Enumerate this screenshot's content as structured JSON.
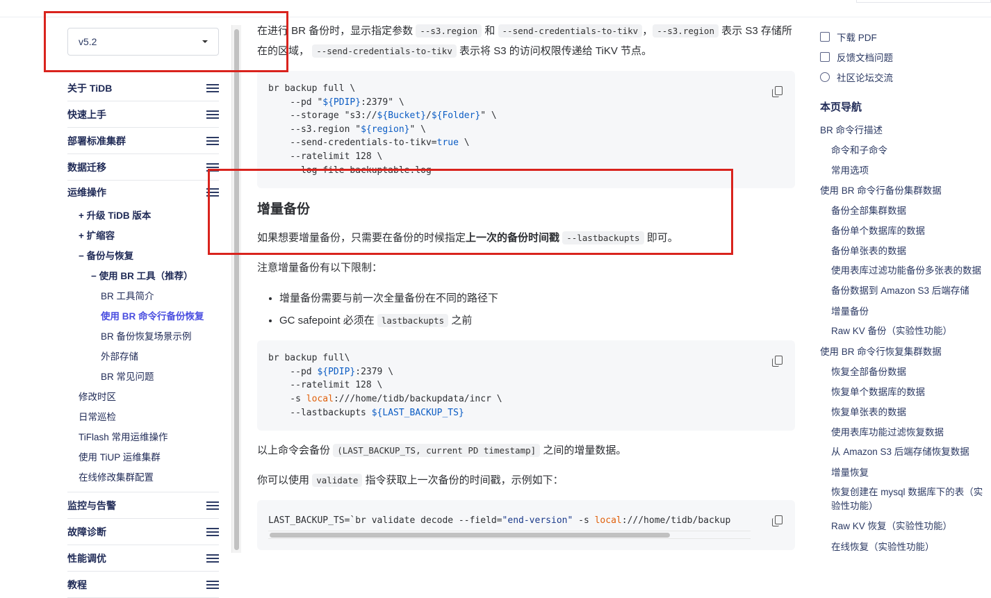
{
  "version": "v5.2",
  "sidebar": {
    "sections_top": [
      "关于 TiDB",
      "快速上手",
      "部署标准集群",
      "数据迁移"
    ],
    "open_section": "运维操作",
    "subs": [
      {
        "label": "+ 升级 TiDB 版本",
        "indent": 1,
        "bold": true
      },
      {
        "label": "+ 扩缩容",
        "indent": 1,
        "bold": true
      },
      {
        "label": "− 备份与恢复",
        "indent": 1,
        "bold": true
      },
      {
        "label": "− 使用 BR 工具（推荐）",
        "indent": 2,
        "bold": true
      },
      {
        "label": "BR 工具简介",
        "indent": 3
      },
      {
        "label": "使用 BR 命令行备份恢复",
        "indent": 3,
        "active": true
      },
      {
        "label": "BR 备份恢复场景示例",
        "indent": 3
      },
      {
        "label": "外部存储",
        "indent": 3
      },
      {
        "label": "BR 常见问题",
        "indent": 3
      },
      {
        "label": "修改时区",
        "indent": 1
      },
      {
        "label": "日常巡检",
        "indent": 1
      },
      {
        "label": "TiFlash 常用运维操作",
        "indent": 1
      },
      {
        "label": "使用 TiUP 运维集群",
        "indent": 1
      },
      {
        "label": "在线修改集群配置",
        "indent": 1
      }
    ],
    "sections_bottom": [
      "监控与告警",
      "故障诊断",
      "性能调优",
      "教程"
    ]
  },
  "main": {
    "p1": {
      "a": "在进行 BR 备份时，显示指定参数",
      "c1": "--s3.region",
      "b": "和",
      "c2": "--send-credentials-to-tikv",
      "c": "，",
      "c3": "--s3.region",
      "d": "表示 S3 存储所在的区域，",
      "c4": "--send-credentials-to-tikv",
      "e": "表示将 S3 的访问权限传递给 TiKV 节点。"
    },
    "code1": [
      [
        [
          "br backup full \\",
          ""
        ]
      ],
      [
        [
          "    --pd \"",
          ""
        ],
        [
          "${PDIP}",
          "k-blue"
        ],
        [
          ":2379\" \\",
          ""
        ]
      ],
      [
        [
          "    --storage \"s3://",
          ""
        ],
        [
          "${Bucket}",
          "k-blue"
        ],
        [
          "/",
          ""
        ],
        [
          "${Folder}",
          "k-blue"
        ],
        [
          "\" \\",
          ""
        ]
      ],
      [
        [
          "    --s3.region \"",
          ""
        ],
        [
          "${region}",
          "k-blue"
        ],
        [
          "\" \\",
          ""
        ]
      ],
      [
        [
          "    --send-credentials-to-tikv=",
          ""
        ],
        [
          "true",
          "k-blue"
        ],
        [
          " \\",
          ""
        ]
      ],
      [
        [
          "    --ratelimit 128 \\",
          ""
        ]
      ],
      [
        [
          "    --log-file backuptable.log",
          ""
        ]
      ]
    ],
    "h_incr": "增量备份",
    "p2": {
      "a": "如果想要增量备份，只需要在备份的时候指定",
      "b": "上一次的备份时间戳",
      "c": "--lastbackupts",
      "d": "即可。"
    },
    "p3": "注意增量备份有以下限制：",
    "li1": "增量备份需要与前一次全量备份在不同的路径下",
    "li2": {
      "a": "GC safepoint 必须在",
      "c": "lastbackupts",
      "b": "之前"
    },
    "code2": [
      [
        [
          "br backup full\\",
          ""
        ]
      ],
      [
        [
          "    --pd ",
          ""
        ],
        [
          "${PDIP}",
          "k-blue"
        ],
        [
          ":2379 \\",
          ""
        ]
      ],
      [
        [
          "    --ratelimit 128 \\",
          ""
        ]
      ],
      [
        [
          "    -s ",
          ""
        ],
        [
          "local",
          "k-orange"
        ],
        [
          ":///home/tidb/backupdata/incr \\",
          ""
        ]
      ],
      [
        [
          "    --lastbackupts ",
          ""
        ],
        [
          "${LAST_BACKUP_TS}",
          "k-blue"
        ]
      ]
    ],
    "p4": {
      "a": "以上命令会备份",
      "c": "(LAST_BACKUP_TS, current PD timestamp]",
      "b": "之间的增量数据。"
    },
    "p5": {
      "a": "你可以使用",
      "c": "validate",
      "b": "指令获取上一次备份的时间戳，示例如下："
    },
    "code3": [
      [
        [
          "LAST_BACKUP_TS=`br validate decode --field=",
          ""
        ],
        [
          "\"end-version\"",
          "k-navy"
        ],
        [
          " -s ",
          ""
        ],
        [
          "local",
          "k-orange"
        ],
        [
          ":///home/tidb/backup",
          ""
        ]
      ]
    ]
  },
  "right": {
    "actions": [
      "下载 PDF",
      "反馈文档问题",
      "社区论坛交流"
    ],
    "toc_title": "本页导航",
    "toc": [
      {
        "label": "BR 命令行描述",
        "level": 1
      },
      {
        "label": "命令和子命令",
        "level": 2
      },
      {
        "label": "常用选项",
        "level": 2
      },
      {
        "label": "使用 BR 命令行备份集群数据",
        "level": 1
      },
      {
        "label": "备份全部集群数据",
        "level": 2
      },
      {
        "label": "备份单个数据库的数据",
        "level": 2
      },
      {
        "label": "备份单张表的数据",
        "level": 2
      },
      {
        "label": "使用表库过滤功能备份多张表的数据",
        "level": 2
      },
      {
        "label": "备份数据到 Amazon S3 后端存储",
        "level": 2
      },
      {
        "label": "增量备份",
        "level": 2
      },
      {
        "label": "Raw KV 备份（实验性功能）",
        "level": 2
      },
      {
        "label": "使用 BR 命令行恢复集群数据",
        "level": 1
      },
      {
        "label": "恢复全部备份数据",
        "level": 2
      },
      {
        "label": "恢复单个数据库的数据",
        "level": 2
      },
      {
        "label": "恢复单张表的数据",
        "level": 2
      },
      {
        "label": "使用表库功能过滤恢复数据",
        "level": 2
      },
      {
        "label": "从 Amazon S3 后端存储恢复数据",
        "level": 2
      },
      {
        "label": "增量恢复",
        "level": 2
      },
      {
        "label": "恢复创建在 mysql 数据库下的表（实验性功能）",
        "level": 2
      },
      {
        "label": "Raw KV 恢复（实验性功能）",
        "level": 2
      },
      {
        "label": "在线恢复（实验性功能）",
        "level": 2
      }
    ]
  },
  "colors": {
    "accent": "#4a4ee0",
    "annotation": "#d9231d",
    "code_blue": "#0b5cc4",
    "code_orange": "#e0600c"
  }
}
